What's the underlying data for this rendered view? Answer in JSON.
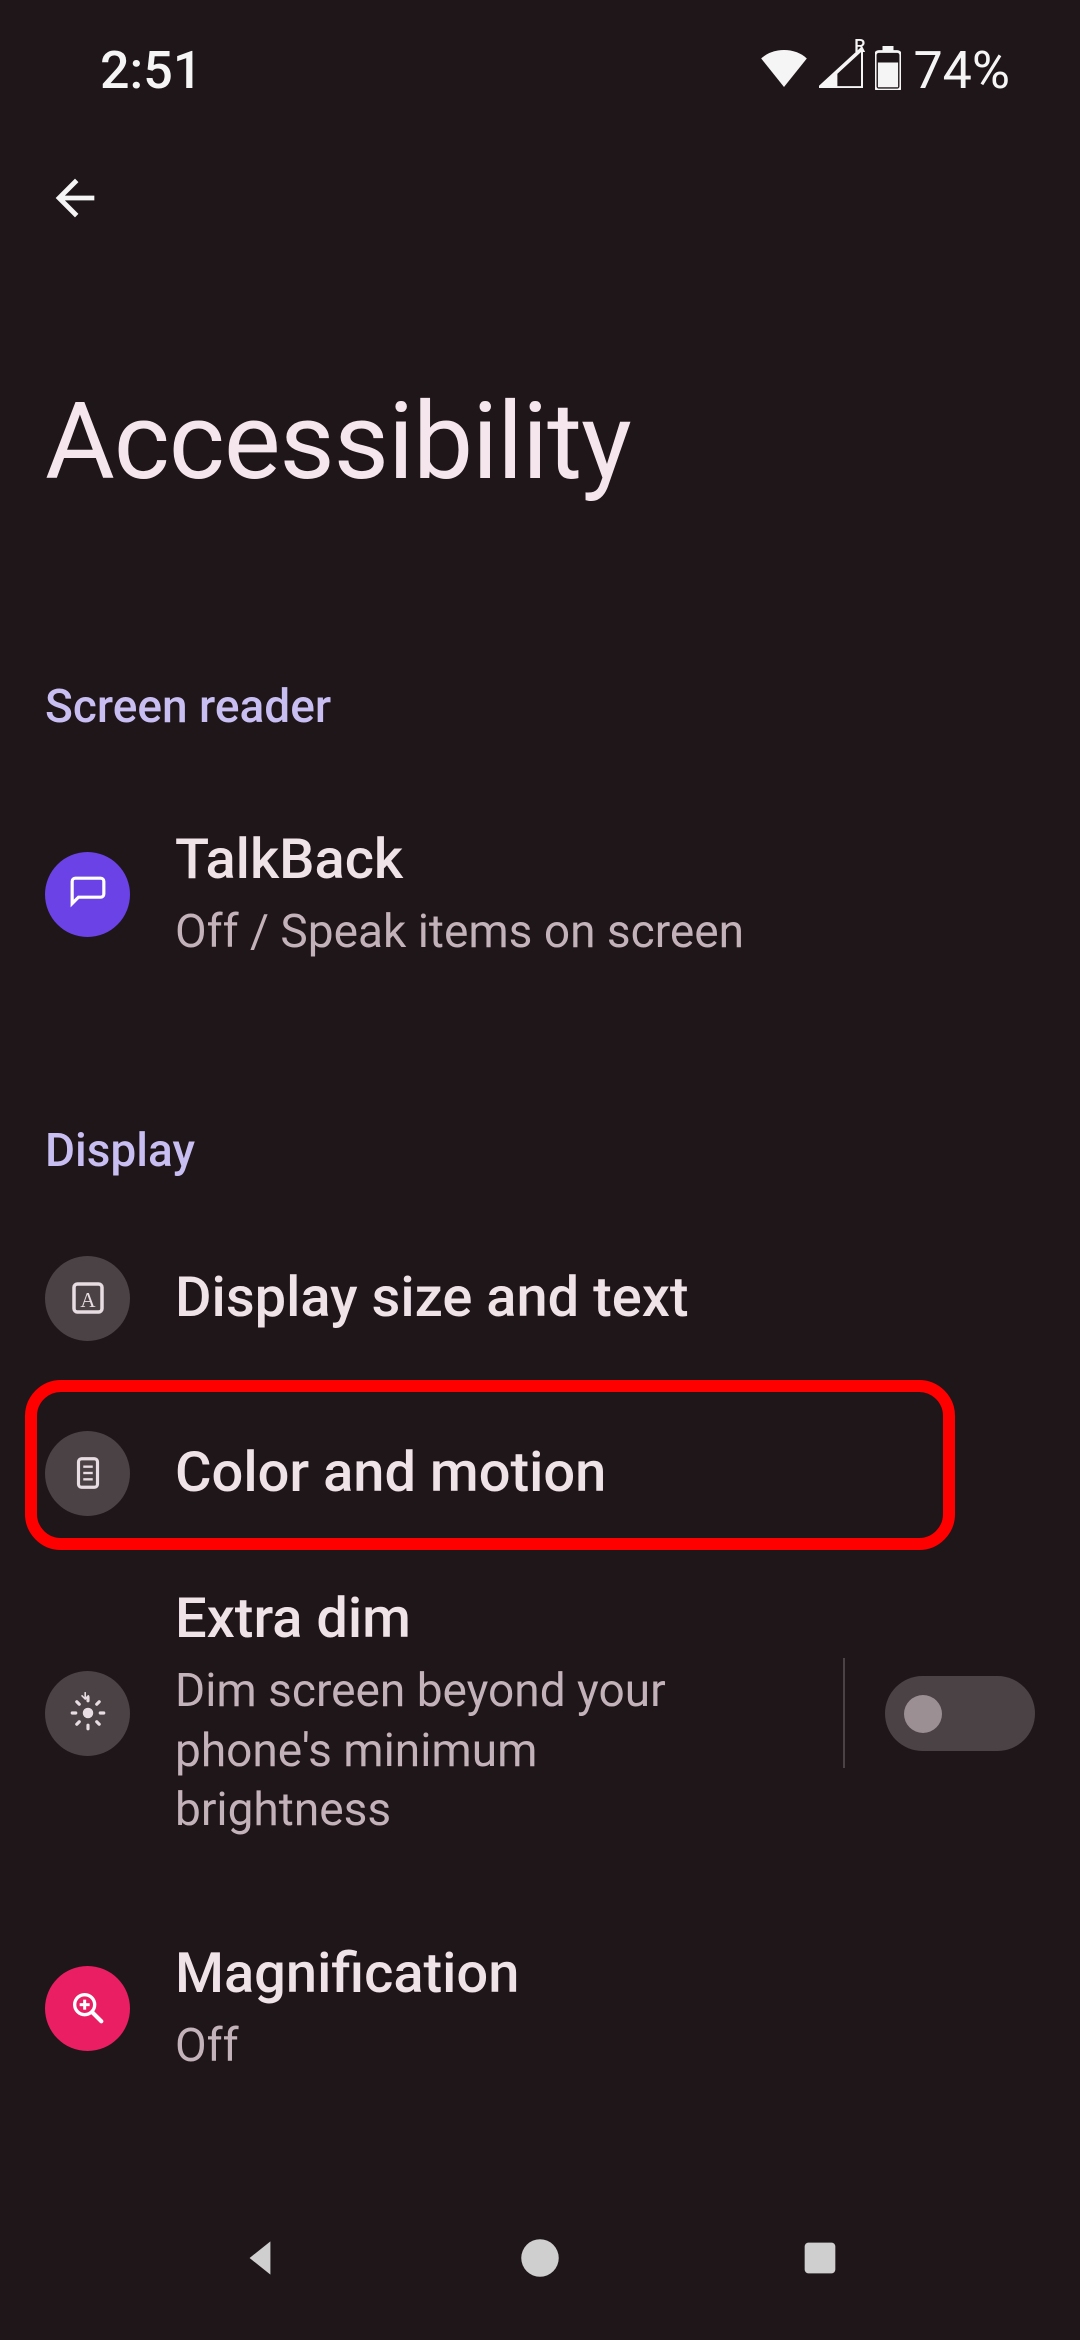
{
  "status": {
    "time": "2:51",
    "battery": "74%"
  },
  "header": {
    "title": "Accessibility"
  },
  "sections": {
    "screen_reader": {
      "label": "Screen reader",
      "items": {
        "talkback": {
          "title": "TalkBack",
          "subtitle": "Off / Speak items on screen"
        }
      }
    },
    "display": {
      "label": "Display",
      "items": {
        "display_size": {
          "title": "Display size and text"
        },
        "color_motion": {
          "title": "Color and motion"
        },
        "extra_dim": {
          "title": "Extra dim",
          "subtitle": "Dim screen beyond your phone's minimum brightness",
          "toggle": false
        },
        "magnification": {
          "title": "Magnification",
          "subtitle": "Off"
        }
      }
    }
  },
  "highlight": "color_motion"
}
